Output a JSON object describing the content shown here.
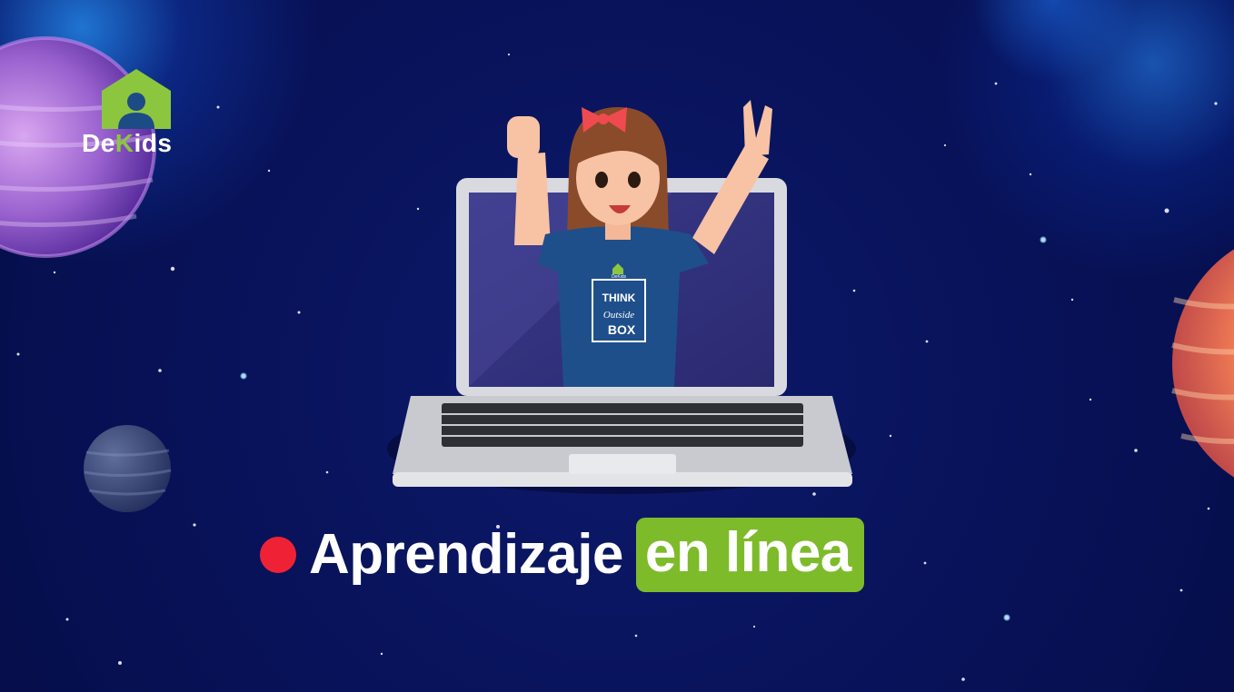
{
  "brand": {
    "name_prefix": "De",
    "name_accent": "K",
    "name_suffix": "ids",
    "accent_color": "#8cc63f"
  },
  "headline": {
    "main": "Aprendizaje",
    "highlight": "en línea",
    "dot_color": "#ef2235",
    "highlight_color": "#7dbb2a"
  },
  "shirt": {
    "line1": "THINK",
    "line2": "Outside",
    "line3": "BOX",
    "brand": "DeKids"
  },
  "icons": [
    "house-logo-icon",
    "planet-icon",
    "star-icon"
  ]
}
